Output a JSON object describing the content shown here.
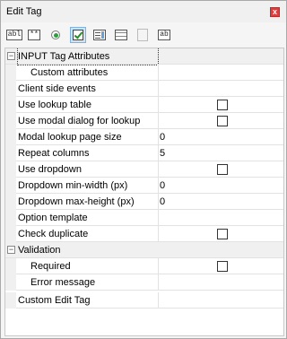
{
  "window": {
    "title": "Edit Tag",
    "close_glyph": "x"
  },
  "toolbar": {
    "buttons": [
      {
        "glyph": "abl",
        "icon": "textbox-icon"
      },
      {
        "glyph": "**",
        "icon": "password-icon"
      },
      {
        "glyph": "",
        "icon": "radio-icon"
      },
      {
        "glyph": "",
        "icon": "checkbox-icon",
        "active": true
      },
      {
        "glyph": "",
        "icon": "select-icon"
      },
      {
        "glyph": "",
        "icon": "listbox-icon"
      },
      {
        "glyph": "",
        "icon": "file-icon",
        "disabled": true
      },
      {
        "glyph": "ab",
        "icon": "textarea-icon"
      }
    ]
  },
  "grid": {
    "categories": [
      {
        "label": "INPUT Tag Attributes",
        "expander": "−"
      },
      {
        "label": "Validation",
        "expander": "−"
      }
    ],
    "rows": [
      {
        "name": "Custom attributes",
        "value": ""
      },
      {
        "name": "Client side events",
        "value": ""
      },
      {
        "name": "Use lookup table",
        "value": ""
      },
      {
        "name": "Use modal dialog for lookup",
        "value": ""
      },
      {
        "name": "Modal lookup page size",
        "value": "0"
      },
      {
        "name": "Repeat columns",
        "value": "5"
      },
      {
        "name": "Use dropdown",
        "value": ""
      },
      {
        "name": "Dropdown min-width (px)",
        "value": "0"
      },
      {
        "name": "Dropdown max-height (px)",
        "value": "0"
      },
      {
        "name": "Option template",
        "value": ""
      },
      {
        "name": "Check duplicate",
        "value": ""
      },
      {
        "name": "Required",
        "value": ""
      },
      {
        "name": "Error message",
        "value": ""
      },
      {
        "name": "Custom Edit Tag",
        "value": ""
      }
    ]
  }
}
